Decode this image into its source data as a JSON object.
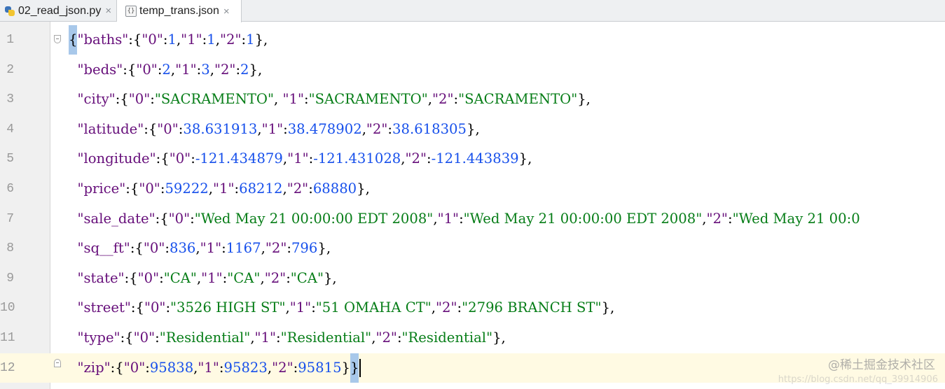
{
  "tabs": [
    {
      "label": "02_read_json.py",
      "icon": "python-file-icon",
      "close": "×",
      "active": false
    },
    {
      "label": "temp_trans.json",
      "icon": "json-file-icon",
      "close": "×",
      "active": true
    }
  ],
  "editor": {
    "current_line": 12,
    "lines": [
      {
        "number": "1",
        "tokens": [
          [
            "p",
            "{"
          ],
          [
            "k",
            "\"baths\""
          ],
          [
            "p",
            ":{"
          ],
          [
            "k",
            "\"0\""
          ],
          [
            "p",
            ":"
          ],
          [
            "n",
            "1"
          ],
          [
            "p",
            ","
          ],
          [
            "k",
            "\"1\""
          ],
          [
            "p",
            ":"
          ],
          [
            "n",
            "1"
          ],
          [
            "p",
            ","
          ],
          [
            "k",
            "\"2\""
          ],
          [
            "p",
            ":"
          ],
          [
            "n",
            "1"
          ],
          [
            "p",
            "},"
          ]
        ]
      },
      {
        "number": "2",
        "tokens": [
          [
            "p",
            "  "
          ],
          [
            "k",
            "\"beds\""
          ],
          [
            "p",
            ":{"
          ],
          [
            "k",
            "\"0\""
          ],
          [
            "p",
            ":"
          ],
          [
            "n",
            "2"
          ],
          [
            "p",
            ","
          ],
          [
            "k",
            "\"1\""
          ],
          [
            "p",
            ":"
          ],
          [
            "n",
            "3"
          ],
          [
            "p",
            ","
          ],
          [
            "k",
            "\"2\""
          ],
          [
            "p",
            ":"
          ],
          [
            "n",
            "2"
          ],
          [
            "p",
            "},"
          ]
        ]
      },
      {
        "number": "3",
        "tokens": [
          [
            "p",
            "  "
          ],
          [
            "k",
            "\"city\""
          ],
          [
            "p",
            ":{"
          ],
          [
            "k",
            "\"0\""
          ],
          [
            "p",
            ":"
          ],
          [
            "s",
            "\"SACRAMENTO\""
          ],
          [
            "p",
            ", "
          ],
          [
            "k",
            "\"1\""
          ],
          [
            "p",
            ":"
          ],
          [
            "s",
            "\"SACRAMENTO\""
          ],
          [
            "p",
            ","
          ],
          [
            "k",
            "\"2\""
          ],
          [
            "p",
            ":"
          ],
          [
            "s",
            "\"SACRAMENTO\""
          ],
          [
            "p",
            "},"
          ]
        ]
      },
      {
        "number": "4",
        "tokens": [
          [
            "p",
            "  "
          ],
          [
            "k",
            "\"latitude\""
          ],
          [
            "p",
            ":{"
          ],
          [
            "k",
            "\"0\""
          ],
          [
            "p",
            ":"
          ],
          [
            "n",
            "38.631913"
          ],
          [
            "p",
            ","
          ],
          [
            "k",
            "\"1\""
          ],
          [
            "p",
            ":"
          ],
          [
            "n",
            "38.478902"
          ],
          [
            "p",
            ","
          ],
          [
            "k",
            "\"2\""
          ],
          [
            "p",
            ":"
          ],
          [
            "n",
            "38.618305"
          ],
          [
            "p",
            "},"
          ]
        ]
      },
      {
        "number": "5",
        "tokens": [
          [
            "p",
            "  "
          ],
          [
            "k",
            "\"longitude\""
          ],
          [
            "p",
            ":{"
          ],
          [
            "k",
            "\"0\""
          ],
          [
            "p",
            ":"
          ],
          [
            "n",
            "-121.434879"
          ],
          [
            "p",
            ","
          ],
          [
            "k",
            "\"1\""
          ],
          [
            "p",
            ":"
          ],
          [
            "n",
            "-121.431028"
          ],
          [
            "p",
            ","
          ],
          [
            "k",
            "\"2\""
          ],
          [
            "p",
            ":"
          ],
          [
            "n",
            "-121.443839"
          ],
          [
            "p",
            "},"
          ]
        ]
      },
      {
        "number": "6",
        "tokens": [
          [
            "p",
            "  "
          ],
          [
            "k",
            "\"price\""
          ],
          [
            "p",
            ":{"
          ],
          [
            "k",
            "\"0\""
          ],
          [
            "p",
            ":"
          ],
          [
            "n",
            "59222"
          ],
          [
            "p",
            ","
          ],
          [
            "k",
            "\"1\""
          ],
          [
            "p",
            ":"
          ],
          [
            "n",
            "68212"
          ],
          [
            "p",
            ","
          ],
          [
            "k",
            "\"2\""
          ],
          [
            "p",
            ":"
          ],
          [
            "n",
            "68880"
          ],
          [
            "p",
            "},"
          ]
        ]
      },
      {
        "number": "7",
        "tokens": [
          [
            "p",
            "  "
          ],
          [
            "k",
            "\"sale_date\""
          ],
          [
            "p",
            ":{"
          ],
          [
            "k",
            "\"0\""
          ],
          [
            "p",
            ":"
          ],
          [
            "s",
            "\"Wed May 21 00:00:00 EDT 2008\""
          ],
          [
            "p",
            ","
          ],
          [
            "k",
            "\"1\""
          ],
          [
            "p",
            ":"
          ],
          [
            "s",
            "\"Wed May 21 00:00:00 EDT 2008\""
          ],
          [
            "p",
            ","
          ],
          [
            "k",
            "\"2\""
          ],
          [
            "p",
            ":"
          ],
          [
            "s",
            "\"Wed May 21 00:0"
          ]
        ]
      },
      {
        "number": "8",
        "tokens": [
          [
            "p",
            "  "
          ],
          [
            "k",
            "\"sq__ft\""
          ],
          [
            "p",
            ":{"
          ],
          [
            "k",
            "\"0\""
          ],
          [
            "p",
            ":"
          ],
          [
            "n",
            "836"
          ],
          [
            "p",
            ","
          ],
          [
            "k",
            "\"1\""
          ],
          [
            "p",
            ":"
          ],
          [
            "n",
            "1167"
          ],
          [
            "p",
            ","
          ],
          [
            "k",
            "\"2\""
          ],
          [
            "p",
            ":"
          ],
          [
            "n",
            "796"
          ],
          [
            "p",
            "},"
          ]
        ]
      },
      {
        "number": "9",
        "tokens": [
          [
            "p",
            "  "
          ],
          [
            "k",
            "\"state\""
          ],
          [
            "p",
            ":{"
          ],
          [
            "k",
            "\"0\""
          ],
          [
            "p",
            ":"
          ],
          [
            "s",
            "\"CA\""
          ],
          [
            "p",
            ","
          ],
          [
            "k",
            "\"1\""
          ],
          [
            "p",
            ":"
          ],
          [
            "s",
            "\"CA\""
          ],
          [
            "p",
            ","
          ],
          [
            "k",
            "\"2\""
          ],
          [
            "p",
            ":"
          ],
          [
            "s",
            "\"CA\""
          ],
          [
            "p",
            "},"
          ]
        ]
      },
      {
        "number": "10",
        "tokens": [
          [
            "p",
            "  "
          ],
          [
            "k",
            "\"street\""
          ],
          [
            "p",
            ":{"
          ],
          [
            "k",
            "\"0\""
          ],
          [
            "p",
            ":"
          ],
          [
            "s",
            "\"3526 HIGH ST\""
          ],
          [
            "p",
            ","
          ],
          [
            "k",
            "\"1\""
          ],
          [
            "p",
            ":"
          ],
          [
            "s",
            "\"51 OMAHA CT\""
          ],
          [
            "p",
            ","
          ],
          [
            "k",
            "\"2\""
          ],
          [
            "p",
            ":"
          ],
          [
            "s",
            "\"2796 BRANCH ST\""
          ],
          [
            "p",
            "},"
          ]
        ]
      },
      {
        "number": "11",
        "tokens": [
          [
            "p",
            "  "
          ],
          [
            "k",
            "\"type\""
          ],
          [
            "p",
            ":{"
          ],
          [
            "k",
            "\"0\""
          ],
          [
            "p",
            ":"
          ],
          [
            "s",
            "\"Residential\""
          ],
          [
            "p",
            ","
          ],
          [
            "k",
            "\"1\""
          ],
          [
            "p",
            ":"
          ],
          [
            "s",
            "\"Residential\""
          ],
          [
            "p",
            ","
          ],
          [
            "k",
            "\"2\""
          ],
          [
            "p",
            ":"
          ],
          [
            "s",
            "\"Residential\""
          ],
          [
            "p",
            "},"
          ]
        ]
      },
      {
        "number": "12",
        "tokens": [
          [
            "p",
            "  "
          ],
          [
            "k",
            "\"zip\""
          ],
          [
            "p",
            ":{"
          ],
          [
            "k",
            "\"0\""
          ],
          [
            "p",
            ":"
          ],
          [
            "n",
            "95838"
          ],
          [
            "p",
            ","
          ],
          [
            "k",
            "\"1\""
          ],
          [
            "p",
            ":"
          ],
          [
            "n",
            "95823"
          ],
          [
            "p",
            ","
          ],
          [
            "k",
            "\"2\""
          ],
          [
            "p",
            ":"
          ],
          [
            "n",
            "95815"
          ],
          [
            "p",
            "}"
          ],
          [
            "b",
            "}"
          ]
        ]
      }
    ]
  },
  "colors": {
    "key": "#660e7a",
    "string": "#067d17",
    "number": "#1750eb",
    "brace_highlight": "#a8c8ea",
    "current_line": "#fffae3"
  },
  "watermark": {
    "main": "@稀土掘金技术社区",
    "sub": "https://blog.csdn.net/qq_39914906"
  }
}
